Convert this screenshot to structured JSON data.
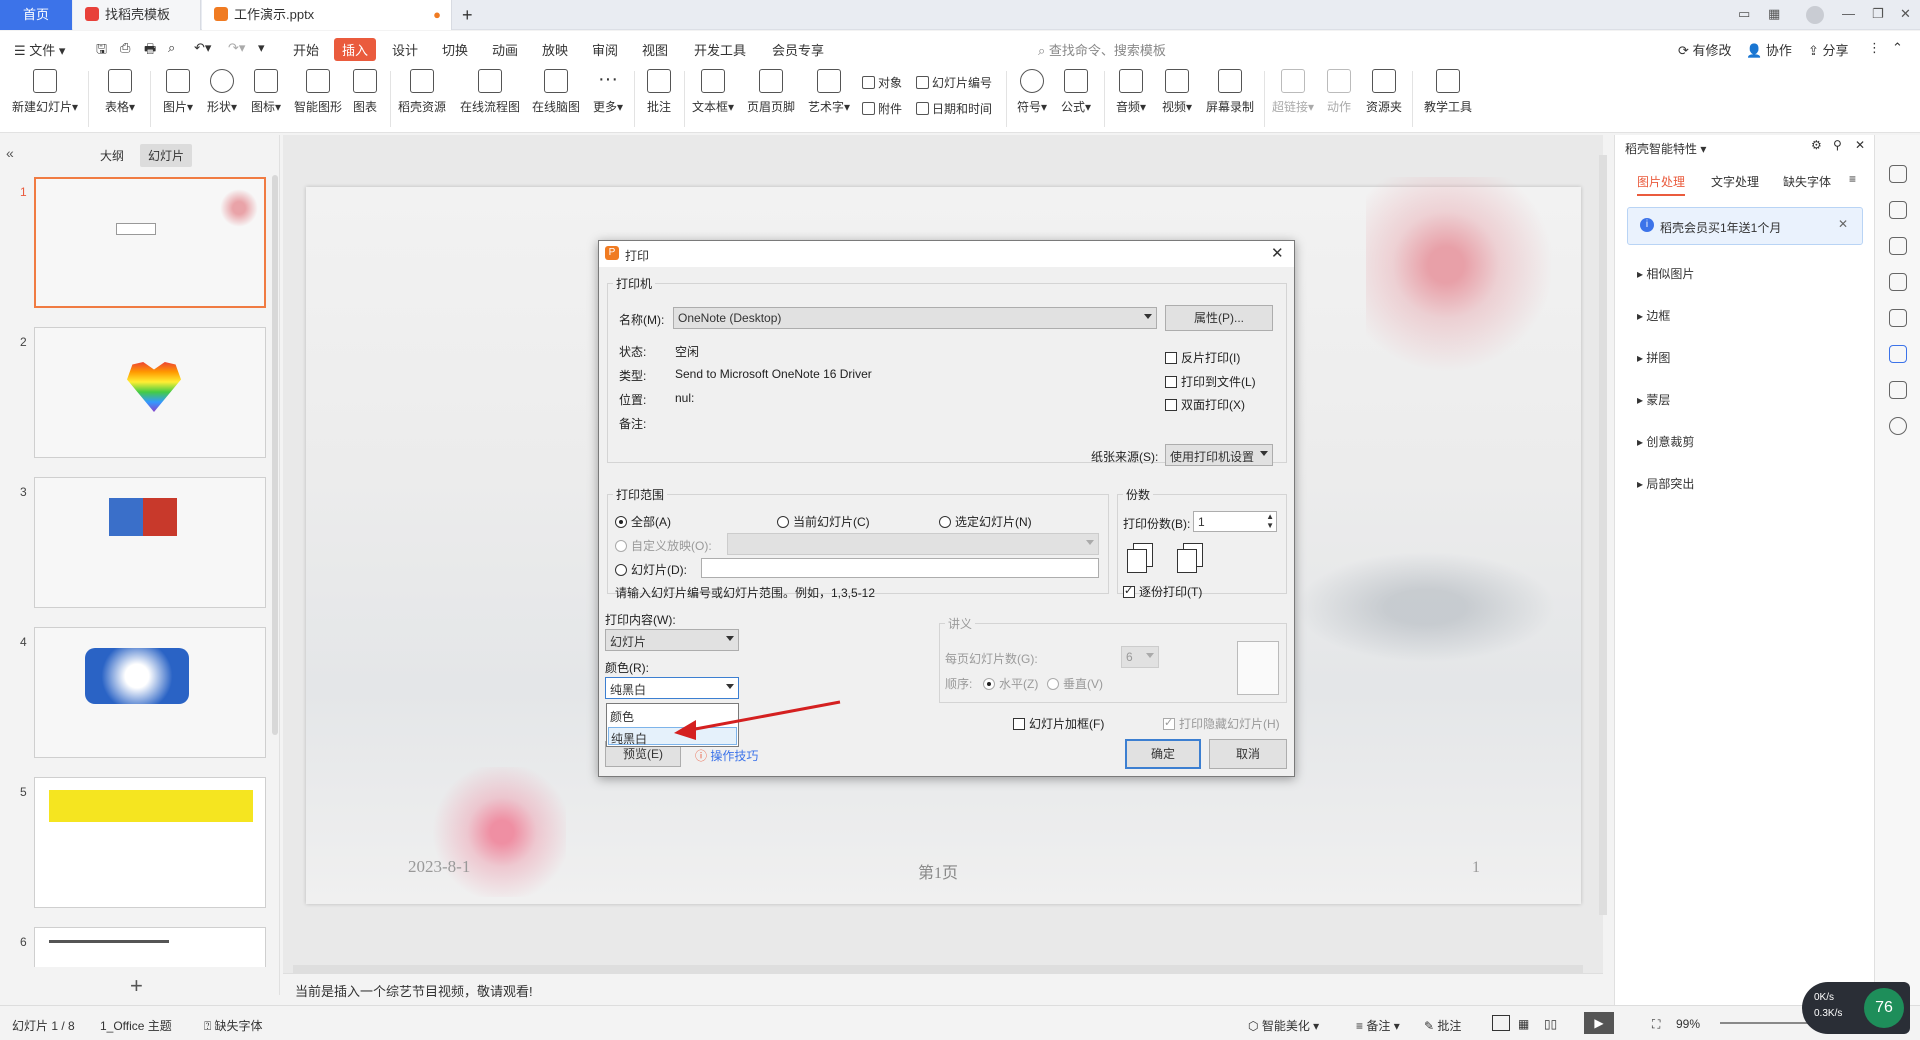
{
  "tabs": {
    "home": "首页",
    "template": "找稻壳模板",
    "doc": "工作演示.pptx",
    "add": "+"
  },
  "menu": {
    "file": "文件",
    "items": [
      "开始",
      "插入",
      "设计",
      "切换",
      "动画",
      "放映",
      "审阅",
      "视图",
      "开发工具",
      "会员专享"
    ],
    "search": "查找命令、搜索模板",
    "modified": "有修改",
    "collab": "协作",
    "share": "分享"
  },
  "ribbon": {
    "big": [
      "新建幻灯片",
      "表格",
      "图片",
      "形状",
      "图标",
      "智能图形",
      "图表",
      "稻壳资源",
      "在线流程图",
      "在线脑图",
      "更多",
      "批注",
      "文本框",
      "页眉页脚",
      "艺术字",
      "符号",
      "公式",
      "音频",
      "视频",
      "屏幕录制",
      "超链接",
      "动作",
      "资源夹",
      "教学工具"
    ],
    "small": [
      "对象",
      "幻灯片编号",
      "附件",
      "日期和时间"
    ]
  },
  "left_panel": {
    "tab_outline": "大纲",
    "tab_slides": "幻灯片",
    "slide_numbers": [
      "1",
      "2",
      "3",
      "4",
      "5",
      "6"
    ],
    "add": "+"
  },
  "slide": {
    "date": "2023-8-1",
    "page_label": "第1页",
    "page_num": "1"
  },
  "notes": "当前是插入一个综艺节目视频，敬请观看!",
  "right_panel": {
    "title": "稻壳智能特性",
    "tabs": [
      "图片处理",
      "文字处理",
      "缺失字体"
    ],
    "banner": "稻壳会员买1年送1个月",
    "items": [
      "相似图片",
      "边框",
      "拼图",
      "蒙层",
      "创意裁剪",
      "局部突出"
    ]
  },
  "status": {
    "slide": "幻灯片 1 / 8",
    "theme": "1_Office 主题",
    "font": "缺失字体",
    "beautify": "智能美化",
    "notes": "备注",
    "comment": "批注",
    "zoom": "99%",
    "speed_up": "0K/s",
    "speed_down": "0.3K/s",
    "cpu": "76"
  },
  "dialog": {
    "title": "打印",
    "printer_group": "打印机",
    "name_label": "名称(M):",
    "printer": "OneNote (Desktop)",
    "props": "属性(P)...",
    "status_label": "状态:",
    "status_val": "空闲",
    "type_label": "类型:",
    "type_val": "Send to Microsoft OneNote 16 Driver",
    "where_label": "位置:",
    "where_val": "nul:",
    "comment_label": "备注:",
    "reverse": "反片打印(I)",
    "to_file": "打印到文件(L)",
    "duplex": "双面打印(X)",
    "paper_label": "纸张来源(S):",
    "paper_val": "使用打印机设置",
    "range_group": "打印范围",
    "all": "全部(A)",
    "current": "当前幻灯片(C)",
    "selected": "选定幻灯片(N)",
    "custom": "自定义放映(O):",
    "slides": "幻灯片(D):",
    "range_hint": "请输入幻灯片编号或幻灯片范围。例如，1,3,5-12",
    "copies_group": "份数",
    "copies_label": "打印份数(B):",
    "copies_val": "1",
    "collate": "逐份打印(T)",
    "content_label": "打印内容(W):",
    "content_val": "幻灯片",
    "color_label": "颜色(R):",
    "color_val": "纯黑白",
    "color_options": [
      "颜色",
      "纯黑白"
    ],
    "handout_group": "讲义",
    "per_page": "每页幻灯片数(G):",
    "per_page_val": "6",
    "order": "顺序:",
    "horizontal": "水平(Z)",
    "vertical": "垂直(V)",
    "frame": "幻灯片加框(F)",
    "hidden": "打印隐藏幻灯片(H)",
    "preview": "预览(E)",
    "tips": "操作技巧",
    "ok": "确定",
    "cancel": "取消"
  },
  "colors": {
    "accent": "#ea5b3d",
    "blue": "#3c73e9",
    "arrow": "#d42020"
  }
}
